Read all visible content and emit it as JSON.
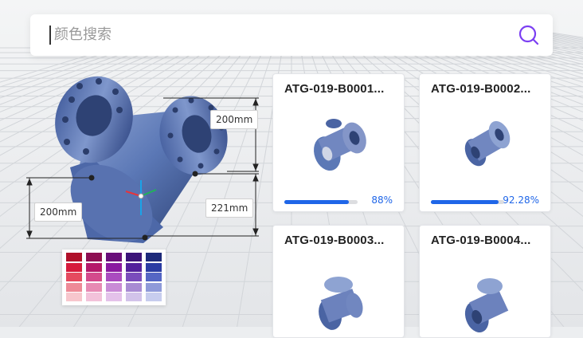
{
  "search": {
    "placeholder": "颜色搜索",
    "icon": "search-icon",
    "accent": "#7b3ff2"
  },
  "viewer": {
    "dimensions": [
      {
        "label": "200mm"
      },
      {
        "label": "200mm"
      },
      {
        "label": "221mm"
      }
    ],
    "model_color": "#5b78b6"
  },
  "palette": {
    "columns": [
      [
        "#b0102a",
        "#d61a3c",
        "#e54a5f",
        "#ee8a97",
        "#f7c6cd"
      ],
      [
        "#8e0f52",
        "#b5196a",
        "#d44a8c",
        "#e78ab3",
        "#f3c2da"
      ],
      [
        "#6a0f7a",
        "#8a1aa0",
        "#aa4bbf",
        "#c98bd6",
        "#e4c2ea"
      ],
      [
        "#3c1478",
        "#53219c",
        "#7a4cbc",
        "#a88bd3",
        "#d2c3ea"
      ],
      [
        "#1e2a7a",
        "#2b3ca3",
        "#5566c4",
        "#8f9ad9",
        "#c7cdee"
      ]
    ]
  },
  "cards": [
    {
      "title": "ATG-019-B0001...",
      "progress": 88,
      "progress_label": "88%"
    },
    {
      "title": "ATG-019-B0002...",
      "progress": 92.28,
      "progress_label": "92.28%"
    },
    {
      "title": "ATG-019-B0003...",
      "progress": null,
      "progress_label": ""
    },
    {
      "title": "ATG-019-B0004...",
      "progress": null,
      "progress_label": ""
    }
  ],
  "colors": {
    "progress": "#1f66e8",
    "title": "#222222"
  }
}
